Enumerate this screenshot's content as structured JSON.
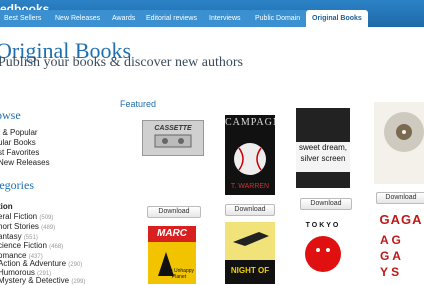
{
  "header": {
    "brand": "edbooks"
  },
  "nav": [
    {
      "label": "Best Sellers"
    },
    {
      "label": "New Releases"
    },
    {
      "label": "Awards"
    },
    {
      "label": "Editorial reviews"
    },
    {
      "label": "Interviews"
    },
    {
      "label": "Public Domain"
    },
    {
      "label": "Original Books"
    }
  ],
  "page": {
    "title": "Original Books",
    "tagline": "Publish your books & discover new authors",
    "featured_label": "Featured"
  },
  "sidebar": {
    "browse_heading": "owse",
    "browse_items": [
      "t & Popular",
      "ular Books",
      "st Favorites",
      "New Releases"
    ],
    "categories_heading": "tegories",
    "categories": [
      {
        "name": "tion",
        "count": ""
      },
      {
        "name": "eral Fiction",
        "count": "(509)"
      },
      {
        "name": "hort Stories",
        "count": "(489)"
      },
      {
        "name": "antasy",
        "count": "(551)"
      },
      {
        "name": "cience Fiction",
        "count": "(468)"
      },
      {
        "name": "omance",
        "count": "(437)"
      },
      {
        "name": "Action & Adventure",
        "count": "(290)"
      },
      {
        "name": "Humorous",
        "count": "(291)"
      },
      {
        "name": "Mystery & Detective",
        "count": "(299)"
      }
    ]
  },
  "books": [
    {
      "title": "CASSETTE",
      "download": "Download"
    },
    {
      "title": "CAMPAGN",
      "author": "T. WARREN",
      "download": "Download"
    },
    {
      "title": "sweet dream, silver screen",
      "download": "Download"
    },
    {
      "title": "",
      "download": "Download"
    },
    {
      "title": "MARC",
      "sub": "The Unhappy Planet"
    },
    {
      "title": "NIGHT OF",
      "sub": ""
    },
    {
      "title": "TOKYO"
    },
    {
      "title": "GAGA"
    }
  ]
}
